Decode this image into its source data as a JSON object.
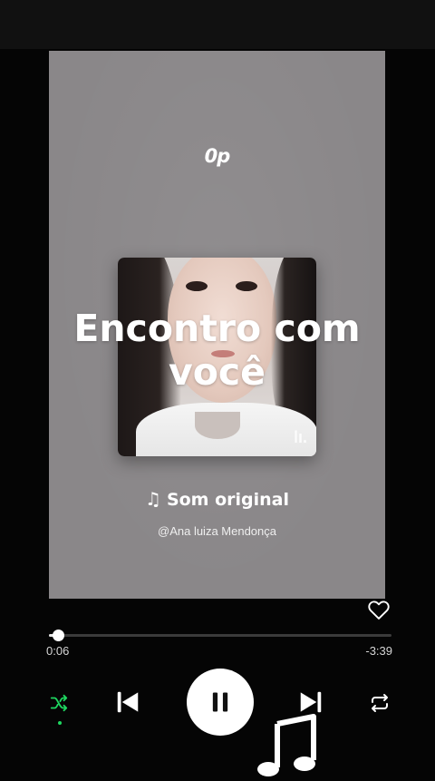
{
  "player": {
    "channel_logo": "0p",
    "track_title": "Encontro com você",
    "sound_label": "Som original",
    "artist": "@Ana luiza Mendonça",
    "time_elapsed": "0:06",
    "time_remaining": "-3:39",
    "progress": 0.027
  },
  "icons": {
    "note": "music-note-icon",
    "heart": "heart-icon",
    "shuffle": "shuffle-icon",
    "previous": "skip-previous-icon",
    "pause": "pause-icon",
    "next": "skip-next-icon",
    "repeat": "repeat-icon"
  },
  "colors": {
    "accent": "#1ed760",
    "background": "#050505",
    "video_bg": "#8a8789"
  }
}
